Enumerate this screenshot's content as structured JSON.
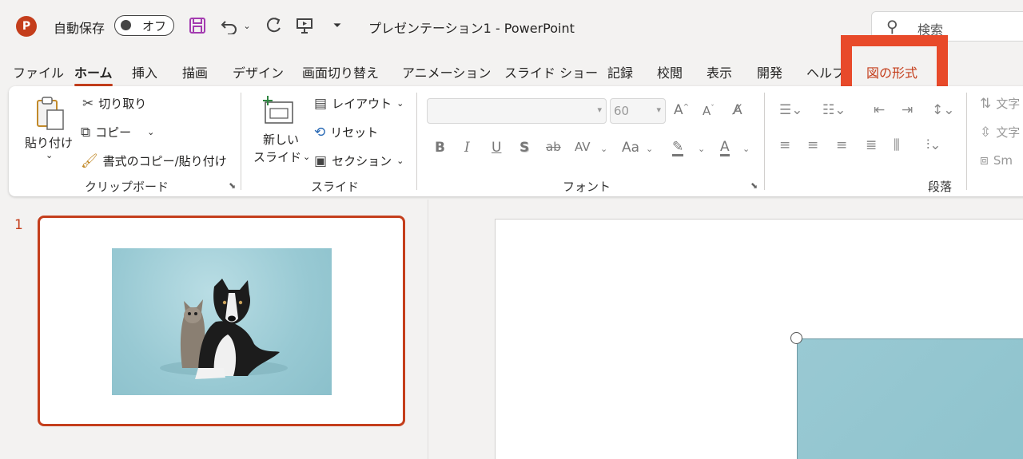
{
  "app": {
    "icon_letter": "P",
    "autosave_label": "自動保存",
    "autosave_state": "オフ",
    "doc_title": "プレゼンテーション1  -  PowerPoint",
    "search_placeholder": "検索",
    "icons": [
      "save-icon",
      "undo-icon",
      "redo-icon",
      "present-icon",
      "customize-icon"
    ]
  },
  "tabs": [
    {
      "label": "ファイル"
    },
    {
      "label": "ホーム"
    },
    {
      "label": "挿入"
    },
    {
      "label": "描画"
    },
    {
      "label": "デザイン"
    },
    {
      "label": "画面切り替え"
    },
    {
      "label": "アニメーション"
    },
    {
      "label": "スライド ショー"
    },
    {
      "label": "記録"
    },
    {
      "label": "校閲"
    },
    {
      "label": "表示"
    },
    {
      "label": "開発"
    },
    {
      "label": "ヘルプ"
    },
    {
      "label": "図の形式"
    }
  ],
  "ribbon": {
    "clipboard": {
      "paste": "貼り付け",
      "cut": "切り取り",
      "copy": "コピー",
      "format_painter": "書式のコピー/貼り付け",
      "group": "クリップボード"
    },
    "slides": {
      "new_slide_line1": "新しい",
      "new_slide_line2": "スライド",
      "layout": "レイアウト",
      "reset": "リセット",
      "section": "セクション",
      "group": "スライド"
    },
    "font": {
      "font_name": "",
      "font_size": "60",
      "group": "フォント",
      "buttons": [
        "B",
        "I",
        "U",
        "S",
        "ab",
        "AV",
        "Aa",
        "A"
      ]
    },
    "paragraph": {
      "group": "段落",
      "text_dir": "文字",
      "align_text": "文字",
      "smartart": "Sm"
    }
  },
  "slides_pane": {
    "slide_number": "1"
  },
  "colors": {
    "accent": "#c43e1c",
    "highlight": "#e84a2a",
    "photo_bg": "#92c6d0"
  }
}
